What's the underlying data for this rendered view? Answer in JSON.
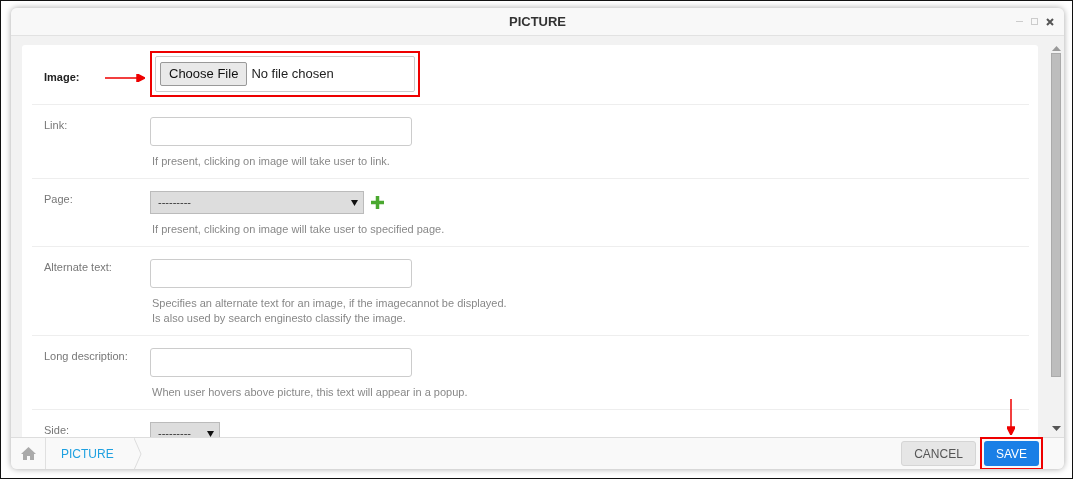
{
  "window": {
    "title": "PICTURE"
  },
  "fields": [
    {
      "kind": "file",
      "label": "Image:",
      "required": true,
      "annotated": true,
      "button": "Choose File",
      "value": "No file chosen"
    },
    {
      "kind": "text",
      "label": "Link:",
      "required": false,
      "annotated": false,
      "help": [
        "If present, clicking on image will take user to link."
      ]
    },
    {
      "kind": "select",
      "label": "Page:",
      "required": false,
      "annotated": false,
      "value": "---------",
      "add_button": true,
      "help": [
        "If present, clicking on image will take user to specified page."
      ]
    },
    {
      "kind": "text",
      "label": "Alternate text:",
      "required": false,
      "annotated": false,
      "help": [
        "Specifies an alternate text for an image, if the imagecannot be displayed.",
        "Is also used by search enginesto classify the image."
      ]
    },
    {
      "kind": "text",
      "label": "Long description:",
      "required": false,
      "annotated": false,
      "help": [
        "When user hovers above picture, this text will appear in a popup."
      ]
    },
    {
      "kind": "select_small",
      "label": "Side:",
      "required": false,
      "annotated": false,
      "value": "---------",
      "add_button": false
    }
  ],
  "breadcrumb": {
    "label": "PICTURE"
  },
  "buttons": [
    {
      "label": "CANCEL",
      "kind": "secondary",
      "annotated": false
    },
    {
      "label": "SAVE",
      "kind": "primary",
      "annotated": true
    }
  ]
}
